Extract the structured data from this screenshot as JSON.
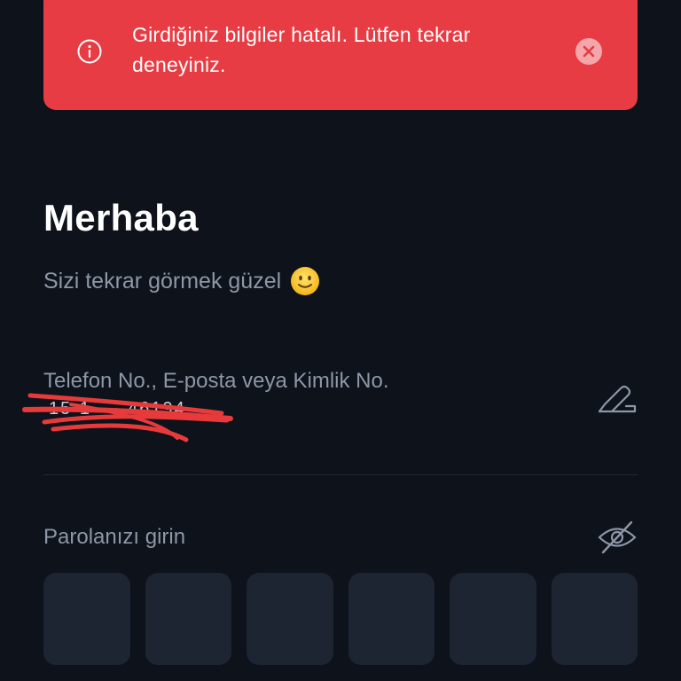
{
  "toast": {
    "message": "Girdiğiniz bilgiler hatalı. Lütfen tekrar deneyiniz.",
    "info_icon": "info-icon",
    "close_icon": "close-icon",
    "color": "#e73c43"
  },
  "greeting": {
    "title": "Merhaba",
    "subtitle": "Sizi tekrar görmek güzel",
    "emoji": "slightly-smiling-face"
  },
  "login_field": {
    "label": "Telefon No., E-posta veya Kimlik No.",
    "value": "15·1 ··· 46194",
    "edit_icon": "edit-icon"
  },
  "password": {
    "label": "Parolanızı girin",
    "visibility_icon": "eye-off-icon",
    "pin_boxes": 6
  },
  "colors": {
    "background": "#0d121b",
    "muted_text": "#8e97a6",
    "pin_box": "#1d2532"
  }
}
